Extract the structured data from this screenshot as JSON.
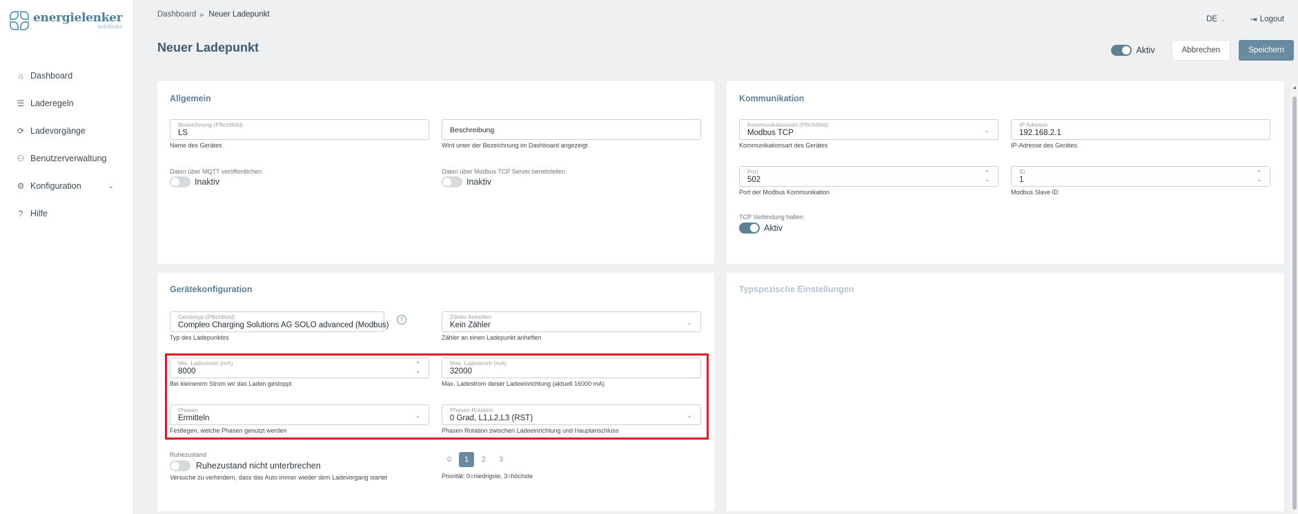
{
  "app": {
    "logo": {
      "brand": "energielenker",
      "sub": "solutions"
    }
  },
  "sidebar": {
    "items": [
      {
        "label": "Dashboard",
        "icon": "home-icon"
      },
      {
        "label": "Laderegeln",
        "icon": "rules-icon"
      },
      {
        "label": "Ladevorgänge",
        "icon": "charging-icon"
      },
      {
        "label": "Benutzerverwaltung",
        "icon": "users-icon"
      },
      {
        "label": "Konfiguration",
        "icon": "gear-icon"
      },
      {
        "label": "Hilfe",
        "icon": "help-icon"
      }
    ]
  },
  "header": {
    "breadcrumb": [
      "Dashboard",
      "Neuer Ladepunkt"
    ],
    "language": "DE",
    "logout": "Logout",
    "title": "Neuer Ladepunkt",
    "active_label": "Aktiv",
    "active_on": true,
    "cancel": "Abbrechen",
    "save": "Speichern"
  },
  "general": {
    "title": "Allgemein",
    "name_label": "Bezeichnung (Pflichtfeld)",
    "name_value": "LS",
    "name_hint": "Name des Gerätes",
    "desc_placeholder": "Beschreibung",
    "desc_hint": "Wird unter der Bezeichnung im Dashboard angezeigt",
    "mqtt_label": "Daten über MQTT veröffentlichen",
    "mqtt_state": "Inaktiv",
    "modbus_label": "Daten über Modbus TCP Server bereitstellen",
    "modbus_state": "Inaktiv"
  },
  "communication": {
    "title": "Kommunikation",
    "type_label": "Kommunikationsart (Pflichtfeld)",
    "type_value": "Modbus TCP",
    "type_hint": "Kommunikationsart des Gerätes",
    "ip_label": "IP Adresse",
    "ip_value": "192.168.2.1",
    "ip_hint": "IP-Adresse des Gerätes",
    "port_label": "Port",
    "port_value": "502",
    "port_hint": "Port der Modbus Kommunikation",
    "id_label": "ID",
    "id_value": "1",
    "id_hint": "Modbus Slave ID",
    "tcp_label": "TCP Verbindung halten",
    "tcp_state": "Aktiv"
  },
  "device_config": {
    "title": "Gerätekonfiguration",
    "type_label": "Gerätetyp (Pflichtfeld)",
    "type_value": "Compleo Charging Solutions AG SOLO advanced (Modbus)",
    "type_hint": "Typ des Ladepunktes",
    "meter_label": "Zähler Anheften",
    "meter_value": "Kein Zähler",
    "meter_hint": "Zähler an einen Ladepunkt anheften",
    "min_label": "Min. Ladestrom (mA)",
    "min_value": "8000",
    "min_hint": "Bei kleinerem Strom wir das Laden gestoppt",
    "max_label": "Max. Ladestrom (mA)",
    "max_value": "32000",
    "max_hint": "Max. Ladestrom dieser Ladeeinrichtung (aktuell 16000 mA)",
    "phases_label": "Phasen",
    "phases_value": "Ermitteln",
    "phases_hint": "Festlegen, welche Phasen genutzt werden",
    "rotation_label": "Phasen Rotation",
    "rotation_value": "0 Grad, L1,L2,L3 (RST)",
    "rotation_hint": "Phasen Rotation zwischen Ladeeinrichtung und Hauptanschluss",
    "sleep_label": "Ruhezustand",
    "sleep_toggle": "Ruhezustand nicht unterbrechen",
    "sleep_hint": "Versuche zu verhindern, dass das Auto immer wieder dem Ladevorgang startet",
    "priority_options": [
      "0",
      "1",
      "2",
      "3"
    ],
    "priority_selected": "1",
    "priority_hint": "Priorität: 0=niedrigste, 3=höchste"
  },
  "type_settings": {
    "title": "Typspezische Einstellungen"
  },
  "colors": {
    "accent": "#6a8aa0",
    "highlight": "#e01b24",
    "title": "#3d5a70"
  }
}
